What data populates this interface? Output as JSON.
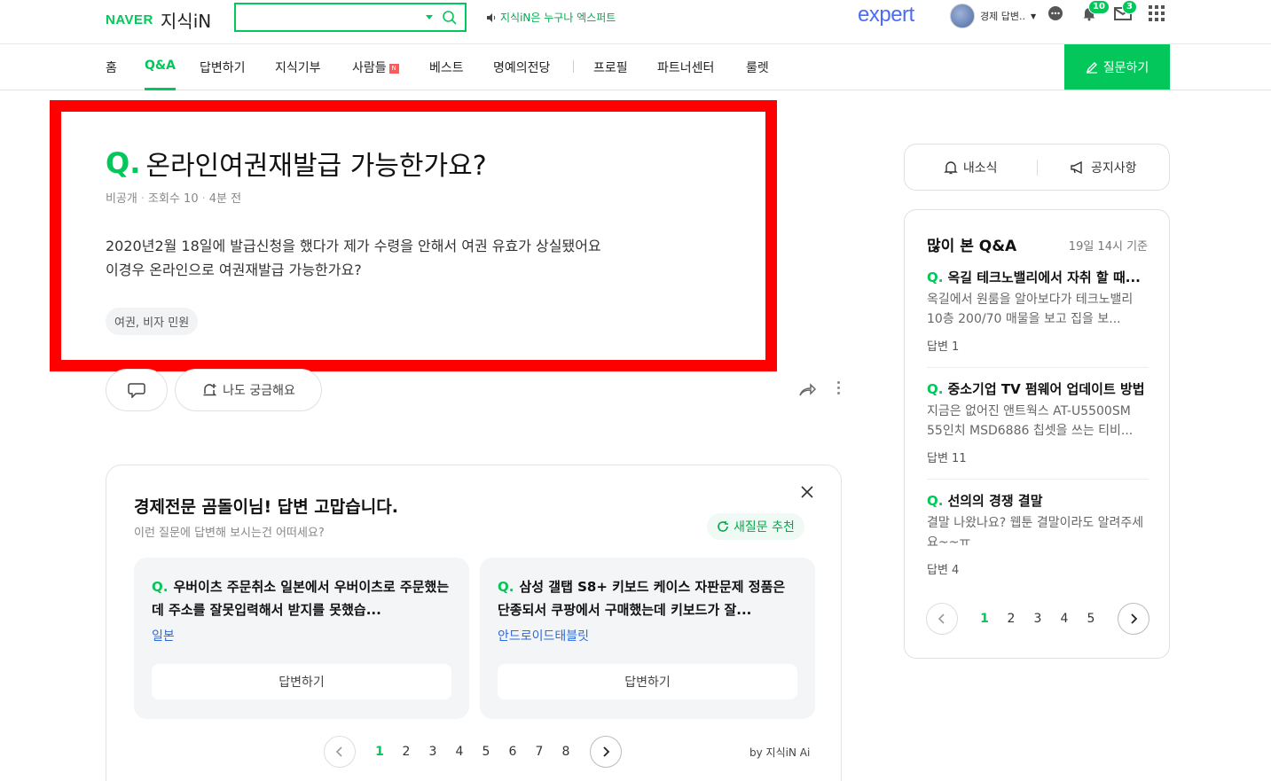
{
  "header": {
    "naver_label": "NAVER",
    "kin_label": "지식iN",
    "search_placeholder": "",
    "notice_text": "지식iN은 누구나 엑스퍼트",
    "expert_label": "expert",
    "user_name": "경제 답변..",
    "notification_count": "10",
    "mail_count": "3"
  },
  "nav": {
    "items": [
      "홈",
      "Q&A",
      "답변하기",
      "지식기부",
      "사람들",
      "베스트",
      "명예의전당",
      "프로필",
      "파트너센터",
      "룰렛"
    ],
    "new_badge": "N",
    "ask_button": "질문하기"
  },
  "question": {
    "q_mark": "Q.",
    "title": "온라인여권재발급 가능한가요?",
    "visibility": "비공개",
    "views": "조회수 10",
    "time": "4분 전",
    "body_line1": "2020년2월 18일에 발급신청을 했다가 제가 수령을 안해서 여권 유효가 상실됐어요",
    "body_line2": "이경우 온라인으로 여권재발급 가능한가요?",
    "tag": "여권, 비자 민원",
    "curious_button": "나도 궁금해요"
  },
  "recommend": {
    "title": "경제전문 곰돌이님! 답변 고맙습니다.",
    "subtitle": "이런 질문에 답변해 보시는건 어떠세요?",
    "refresh_button": "새질문 추천",
    "questions": [
      {
        "q": "Q.",
        "text": "우버이츠 주문취소 일본에서 우버이츠로 주문했는데 주소를 잘못입력해서 받지를 못했습...",
        "category": "일본",
        "answer_button": "답변하기"
      },
      {
        "q": "Q.",
        "text": "삼성 갤탭 S8+ 키보드 케이스 자판문제 정품은 단종되서 쿠팡에서 구매했는데 키보드가 잘...",
        "category": "안드로이드태블릿",
        "answer_button": "답변하기"
      }
    ],
    "pages": [
      "1",
      "2",
      "3",
      "4",
      "5",
      "6",
      "7",
      "8"
    ],
    "by_ai": "by 지식iN Ai"
  },
  "sidebar": {
    "my_news": "내소식",
    "notices": "공지사항",
    "popular_title": "많이 본 Q&A",
    "popular_date": "19일 14시 기준",
    "items": [
      {
        "q": "Q.",
        "title": "옥길 테크노밸리에서 자취 할 때...",
        "body": "옥길에서 원룸을 알아보다가 테크노밸리 10층 200/70 매물을 보고 집을 보...",
        "count": "답변 1"
      },
      {
        "q": "Q.",
        "title": "중소기업 TV 펌웨어 업데이트 방법",
        "body": "지금은 없어진 앤트웍스 AT-U5500SM 55인치 MSD6886 칩셋을 쓰는 티비...",
        "count": "답변 11"
      },
      {
        "q": "Q.",
        "title": "선의의 경쟁 결말",
        "body": "결말 나왔나요? 웹툰 결말이라도 알려주세요~~ㅠ",
        "count": "답변 4"
      }
    ],
    "pages": [
      "1",
      "2",
      "3",
      "4",
      "5"
    ]
  },
  "colors": {
    "brand": "#03c75a",
    "highlight": "#ff0000",
    "link": "#2e6bd9"
  }
}
